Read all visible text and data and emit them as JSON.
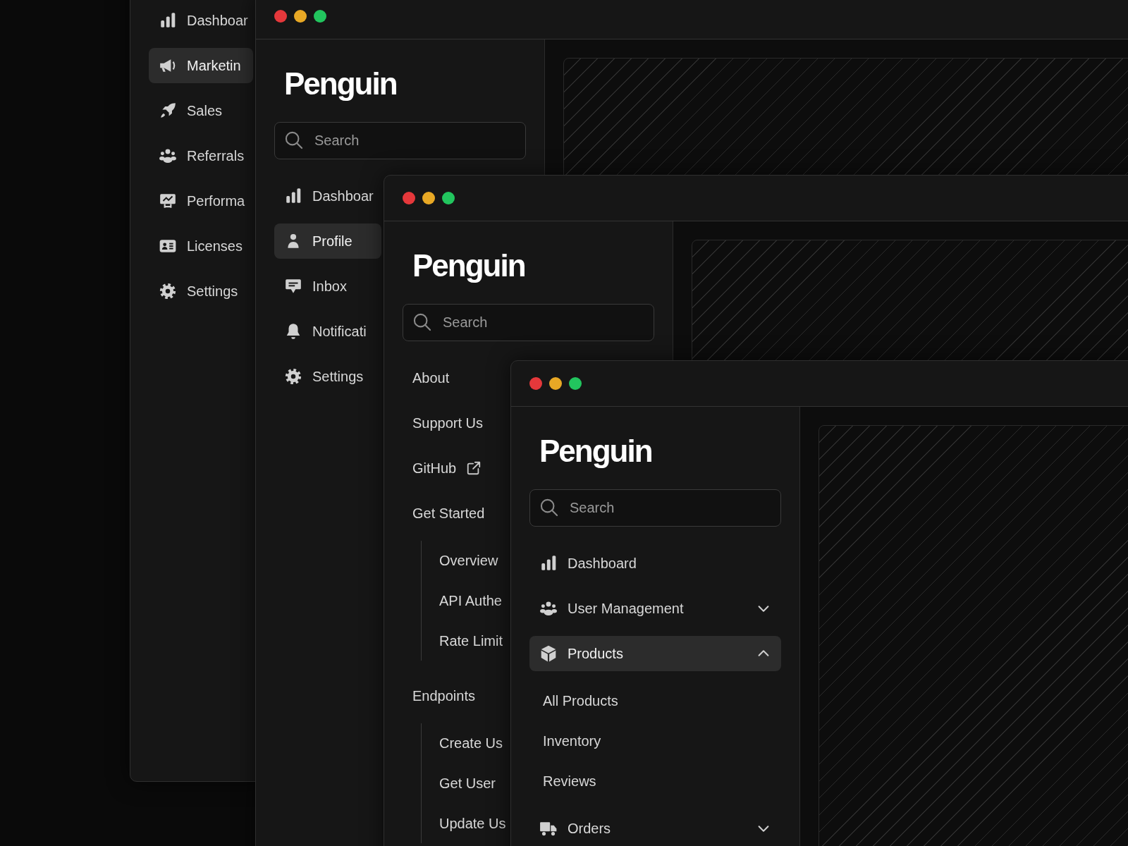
{
  "windows": [
    {
      "nav": [
        {
          "label": "Dashboar",
          "selected": false
        },
        {
          "label": "Marketin",
          "selected": true
        },
        {
          "label": "Sales",
          "selected": false
        },
        {
          "label": "Referrals",
          "selected": false
        },
        {
          "label": "Performa",
          "selected": false
        },
        {
          "label": "Licenses",
          "selected": false
        },
        {
          "label": "Settings",
          "selected": false
        }
      ]
    },
    {
      "logo": "Penguin",
      "search": {
        "placeholder": "Search"
      },
      "nav": [
        {
          "label": "Dashboar",
          "selected": false
        },
        {
          "label": "Profile",
          "selected": true
        },
        {
          "label": "Inbox",
          "selected": false
        },
        {
          "label": "Notificati",
          "selected": false
        },
        {
          "label": "Settings",
          "selected": false
        }
      ]
    },
    {
      "logo": "Penguin",
      "search": {
        "placeholder": "Search"
      },
      "nav": [
        {
          "label": "About",
          "kind": "link",
          "selected": false
        },
        {
          "label": "Support Us",
          "kind": "link",
          "selected": false
        },
        {
          "label": "GitHub",
          "kind": "external",
          "selected": false
        },
        {
          "label": "Get Started",
          "kind": "section",
          "selected": false,
          "children": [
            {
              "label": "Overview",
              "selected": false
            },
            {
              "label": "API Authe",
              "selected": false
            },
            {
              "label": "Rate Limit",
              "selected": false
            }
          ]
        },
        {
          "label": "Endpoints",
          "kind": "section",
          "selected": false,
          "children": [
            {
              "label": "Create Us",
              "selected": false
            },
            {
              "label": "Get User",
              "selected": false
            },
            {
              "label": "Update Us",
              "selected": false
            }
          ]
        }
      ]
    },
    {
      "logo": "Penguin",
      "search": {
        "placeholder": "Search"
      },
      "nav": [
        {
          "label": "Dashboard",
          "selected": false
        },
        {
          "label": "User Management",
          "selected": false,
          "expanded": false
        },
        {
          "label": "Products",
          "selected": true,
          "expanded": true,
          "children": [
            {
              "label": "All Products",
              "selected": false
            },
            {
              "label": "Inventory",
              "selected": false
            },
            {
              "label": "Reviews",
              "selected": false
            }
          ]
        },
        {
          "label": "Orders",
          "selected": false,
          "expanded": false
        }
      ]
    }
  ]
}
